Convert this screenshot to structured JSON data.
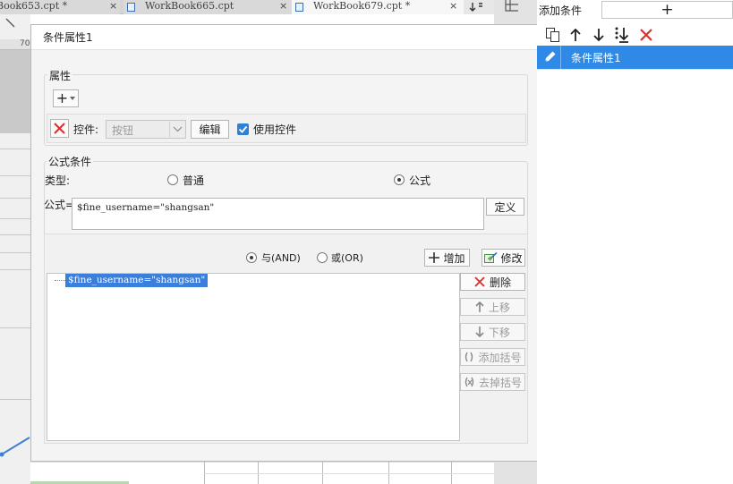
{
  "tabs": [
    {
      "label": "Book653.cpt *",
      "close": "×"
    },
    {
      "label": "WorkBook665.cpt",
      "close": "×"
    },
    {
      "label": "WorkBook679.cpt *",
      "close": "×"
    }
  ],
  "sheet_column_label": "70",
  "dialog": {
    "title": "条件属性1",
    "attributes": {
      "group_label": "属性",
      "add_symbol": "+",
      "control_label": "控件:",
      "control_value": "按钮",
      "edit_button": "编辑",
      "use_control_label": "使用控件",
      "use_control_checked": true
    },
    "formula_condition": {
      "group_label": "公式条件",
      "type_label": "类型:",
      "type_options": [
        "普通",
        "公式"
      ],
      "type_selected": "公式",
      "formula_label": "公式=",
      "formula_value": "$fine_username=\"shangsan\"",
      "define_button": "定义",
      "logic_options": [
        "与(AND)",
        "或(OR)"
      ],
      "logic_selected": "与(AND)",
      "add_button": "增加",
      "modify_button": "修改",
      "tree_items": [
        "$fine_username=\"shangsan\""
      ],
      "side_buttons": [
        {
          "label": "删除",
          "enabled": true
        },
        {
          "label": "上移",
          "enabled": false
        },
        {
          "label": "下移",
          "enabled": false
        },
        {
          "label": "添加括号",
          "enabled": false
        },
        {
          "label": "去掉括号",
          "enabled": false
        }
      ]
    }
  },
  "right_panel": {
    "header_label": "添加条件",
    "add_symbol": "+",
    "items": [
      {
        "label": "条件属性1",
        "selected": true
      }
    ]
  },
  "colors": {
    "accent": "#2e8ae6",
    "delete_red": "#d9302c",
    "checkbox_blue": "#2f7fd6"
  }
}
